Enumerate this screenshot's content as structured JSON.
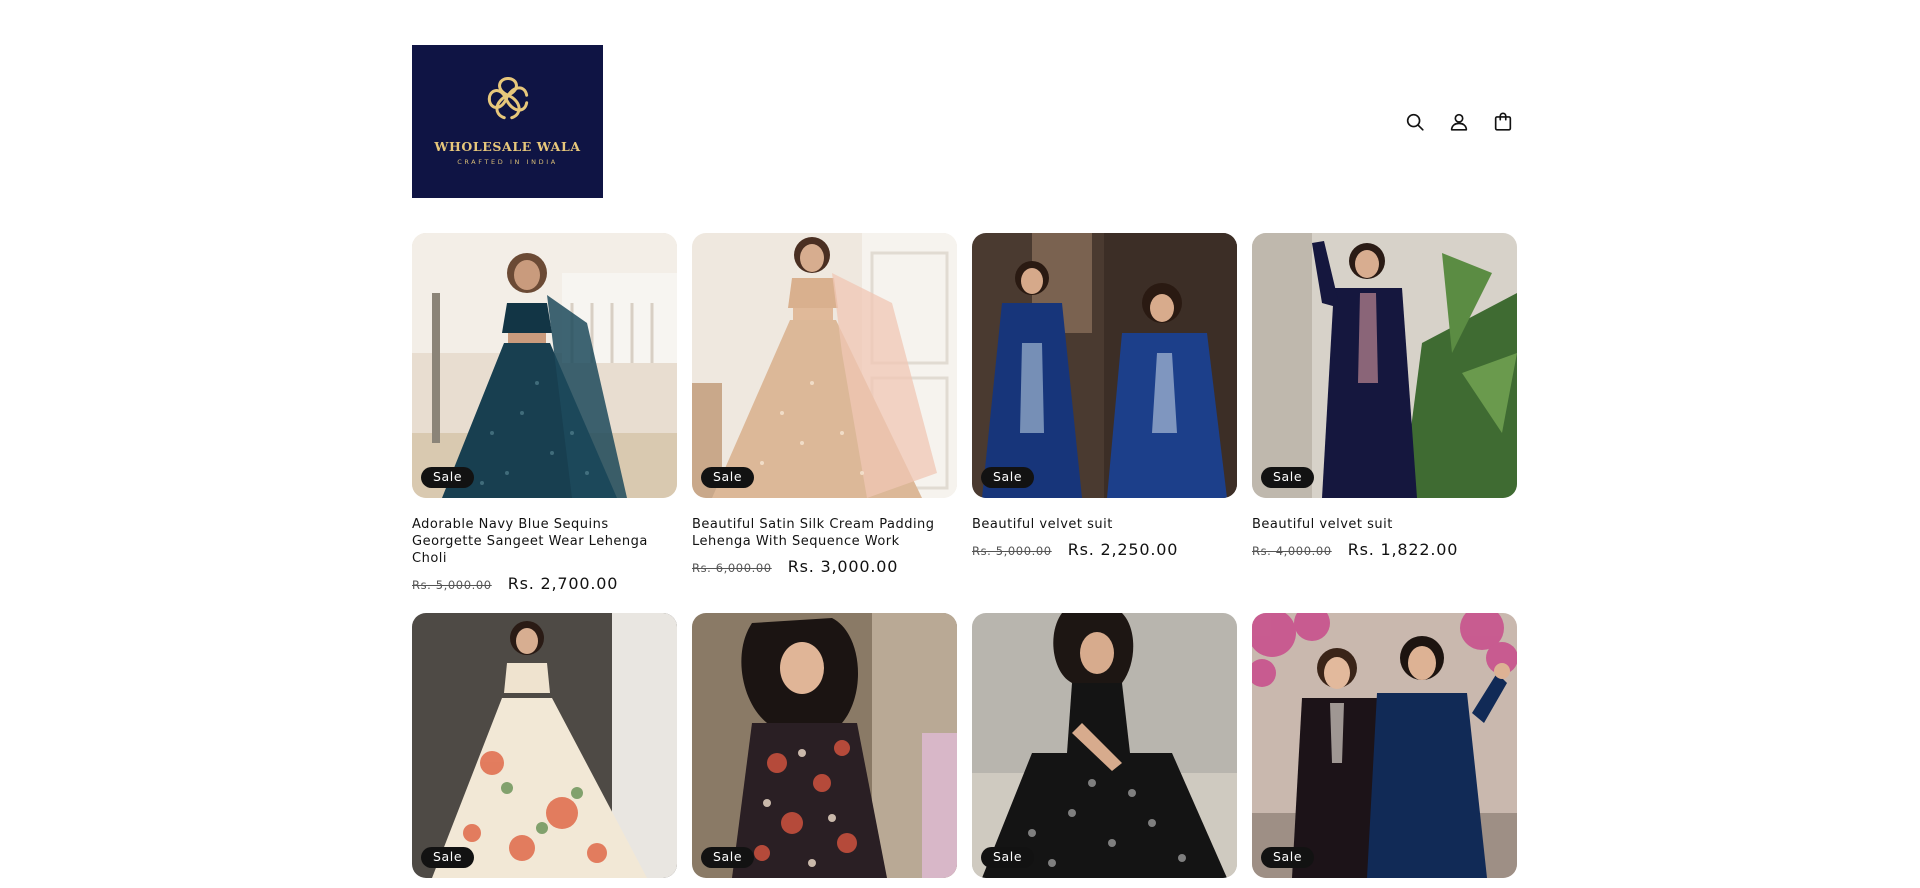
{
  "header": {
    "logo_name": "WHOLESALE WALA",
    "logo_tagline": "CRAFTED IN INDIA",
    "icons": [
      "search-icon",
      "account-icon",
      "cart-icon"
    ]
  },
  "colors": {
    "logo_bg": "#0f1444",
    "logo_gold": "#e7c77b",
    "badge_bg": "#121212",
    "text": "#121212"
  },
  "products": [
    {
      "title": "Adorable Navy Blue Sequins Georgette Sangeet Wear Lehenga Choli",
      "badge": "Sale",
      "price_old": "Rs. 5,000.00",
      "price_new": "Rs. 2,700.00"
    },
    {
      "title": "Beautiful Satin Silk Cream Padding Lehenga With Sequence Work",
      "badge": "Sale",
      "price_old": "Rs. 6,000.00",
      "price_new": "Rs. 3,000.00"
    },
    {
      "title": "Beautiful velvet suit",
      "badge": "Sale",
      "price_old": "Rs. 5,000.00",
      "price_new": "Rs. 2,250.00"
    },
    {
      "title": "Beautiful velvet suit",
      "badge": "Sale",
      "price_old": "Rs. 4,000.00",
      "price_new": "Rs. 1,822.00"
    },
    {
      "badge": "Sale"
    },
    {
      "badge": "Sale"
    },
    {
      "badge": "Sale"
    },
    {
      "badge": "Sale"
    }
  ]
}
